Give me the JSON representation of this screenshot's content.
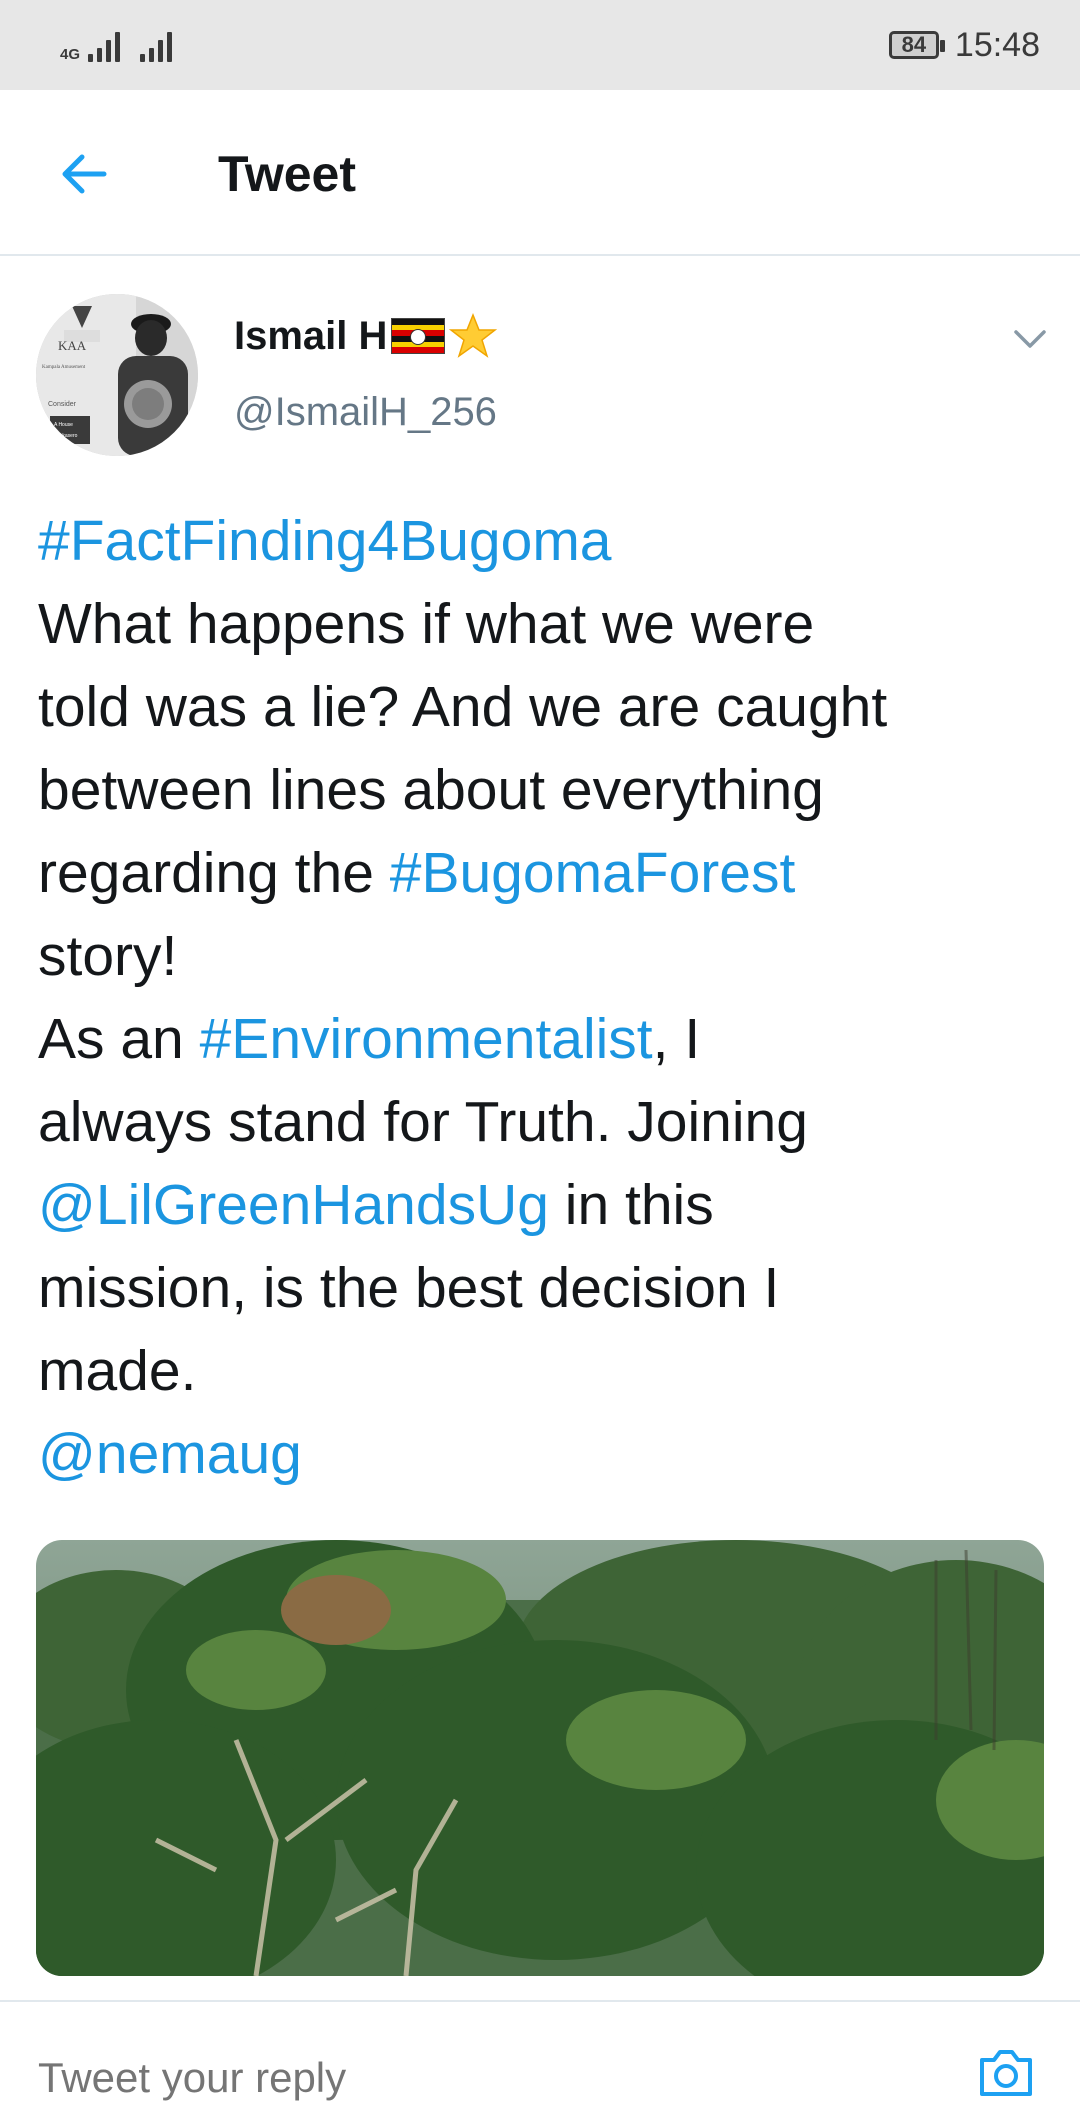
{
  "status_bar": {
    "network_type": "4G",
    "battery": "84",
    "time": "15:48"
  },
  "header": {
    "title": "Tweet"
  },
  "tweet": {
    "author_name": "Ismail H",
    "author_handle": "@IsmailH_256",
    "text_lines": [
      [
        {
          "t": "#FactFinding4Bugoma",
          "link": true
        }
      ],
      [
        {
          "t": "What happens if what we were",
          "link": false
        }
      ],
      [
        {
          "t": "told was a lie? And we are caught",
          "link": false
        }
      ],
      [
        {
          "t": "between lines about everything",
          "link": false
        }
      ],
      [
        {
          "t": "regarding the ",
          "link": false
        },
        {
          "t": "#BugomaForest",
          "link": true
        }
      ],
      [
        {
          "t": "story!",
          "link": false
        }
      ],
      [
        {
          "t": "As an ",
          "link": false
        },
        {
          "t": "#Environmentalist",
          "link": true
        },
        {
          "t": ", I",
          "link": false
        }
      ],
      [
        {
          "t": "always stand for Truth. Joining",
          "link": false
        }
      ],
      [
        {
          "t": "@LilGreenHandsUg",
          "link": true
        },
        {
          "t": " in this",
          "link": false
        }
      ],
      [
        {
          "t": "mission, is the best decision I",
          "link": false
        }
      ],
      [
        {
          "t": "made.",
          "link": false
        }
      ],
      [
        {
          "t": "@nemaug",
          "link": true
        }
      ]
    ],
    "avatar_text": {
      "sign_line1": "KAA",
      "sign_line2": "Kampala Amusement",
      "sign_line3": "Consider",
      "sign_line4": "A House",
      "sign_line5": "Nakasero"
    }
  },
  "reply": {
    "placeholder": "Tweet your reply"
  },
  "icons": {
    "back": "arrow-left-icon",
    "chevron": "chevron-down-icon",
    "camera": "camera-icon",
    "star": "star-icon",
    "flag": "uganda-flag-icon"
  },
  "colors": {
    "link": "#1b95e0",
    "text": "#14171a",
    "secondary": "#657786",
    "divider": "#e1e8ed",
    "status_bar_bg": "#e7e7e7"
  }
}
